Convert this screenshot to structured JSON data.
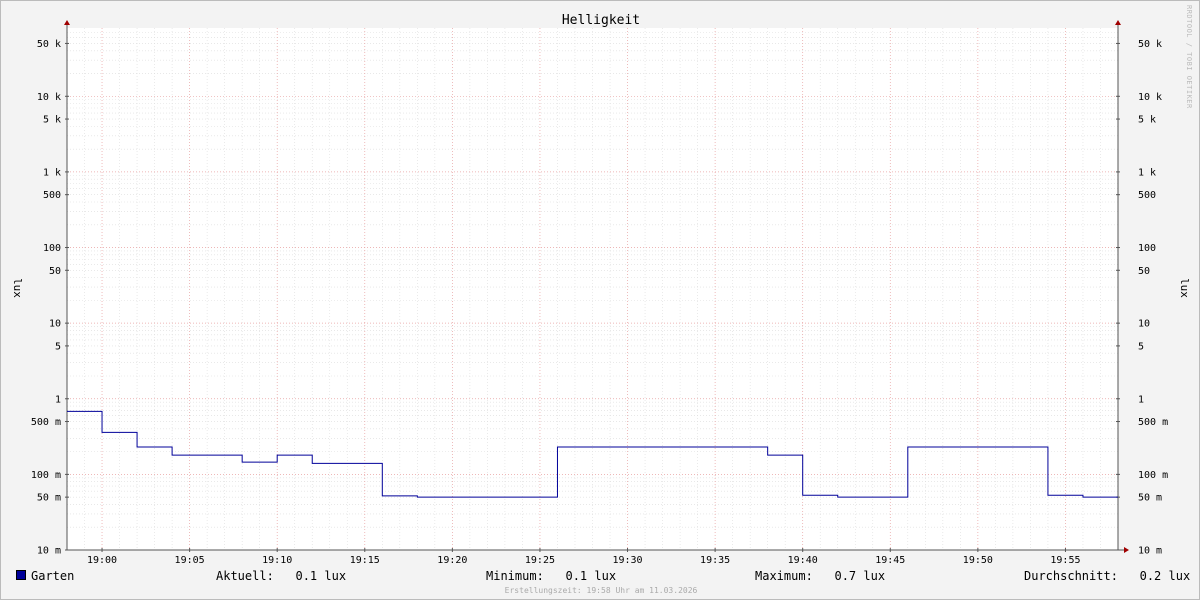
{
  "watermark": "RRDTOOL / TOBI OETIKER",
  "chart_data": {
    "type": "line",
    "title": "Helligkeit",
    "ylabel": "lux",
    "ylabel_right": "lux",
    "yscale": "log",
    "ylim": [
      0.01,
      80000
    ],
    "xlim": [
      "18:58",
      "19:58"
    ],
    "grid": true,
    "x_ticks": [
      "19:00",
      "19:05",
      "19:10",
      "19:15",
      "19:20",
      "19:25",
      "19:30",
      "19:35",
      "19:40",
      "19:45",
      "19:50",
      "19:55"
    ],
    "y_ticks": [
      {
        "value": 50000,
        "label": "50 k"
      },
      {
        "value": 10000,
        "label": "10 k"
      },
      {
        "value": 5000,
        "label": "5 k"
      },
      {
        "value": 1000,
        "label": "1 k"
      },
      {
        "value": 500,
        "label": "500"
      },
      {
        "value": 100,
        "label": "100"
      },
      {
        "value": 50,
        "label": "50"
      },
      {
        "value": 10,
        "label": "10"
      },
      {
        "value": 5,
        "label": "5"
      },
      {
        "value": 1,
        "label": "1"
      },
      {
        "value": 0.5,
        "label": "500 m"
      },
      {
        "value": 0.1,
        "label": "100 m"
      },
      {
        "value": 0.05,
        "label": "50 m"
      },
      {
        "value": 0.01,
        "label": "10 m"
      }
    ],
    "series": [
      {
        "name": "Garten",
        "color": "#000099",
        "step": true,
        "x": [
          "18:58",
          "19:00",
          "19:02",
          "19:04",
          "19:08",
          "19:10",
          "19:12",
          "19:16",
          "19:18",
          "19:26",
          "19:38",
          "19:40",
          "19:42",
          "19:46",
          "19:54",
          "19:56",
          "19:58"
        ],
        "values": [
          0.68,
          0.36,
          0.23,
          0.18,
          0.145,
          0.18,
          0.14,
          0.052,
          0.05,
          0.23,
          0.18,
          0.053,
          0.05,
          0.23,
          0.053,
          0.05,
          0.05
        ]
      }
    ]
  },
  "legend": {
    "series_name": "Garten",
    "swatch_color": "#000099",
    "aktuell": "Aktuell:   0.1 lux",
    "minimum": "Minimum:   0.1 lux",
    "maximum": "Maximum:   0.7 lux",
    "durchschnitt": "Durchschnitt:   0.2 lux"
  },
  "footer": "Erstellungszeit: 19:58 Uhr am 11.03.2026"
}
